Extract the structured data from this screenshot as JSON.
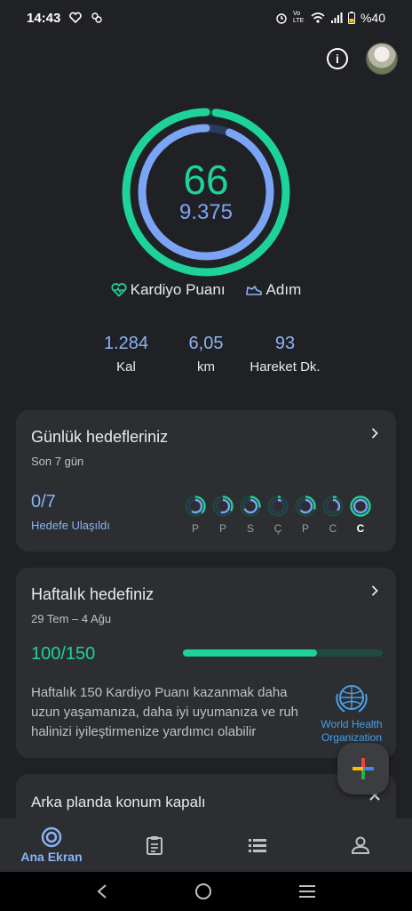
{
  "status_bar": {
    "time": "14:43",
    "battery": "%40",
    "signal_labels": "Vo LTE"
  },
  "ring": {
    "cardio_points": "66",
    "steps": "9.375",
    "cardio_progress": 0.98,
    "steps_progress": 0.94
  },
  "legend": {
    "cardio_label": "Kardiyo Puanı",
    "steps_label": "Adım"
  },
  "stats": [
    {
      "value": "1.284",
      "label": "Kal"
    },
    {
      "value": "6,05",
      "label": "km"
    },
    {
      "value": "93",
      "label": "Hareket Dk."
    }
  ],
  "daily_card": {
    "title": "Günlük hedefleriniz",
    "subtitle": "Son 7 gün",
    "count": "0/7",
    "count_label": "Hedefe Ulaşıldı",
    "days": [
      "P",
      "P",
      "S",
      "Ç",
      "P",
      "C",
      "C"
    ]
  },
  "weekly_card": {
    "title": "Haftalık hedefiniz",
    "date_range": "29 Tem – 4 Ağu",
    "count": "100/150",
    "progress": 0.67,
    "description": "Haftalık 150 Kardiyo Puanı kazanmak daha uzun yaşamanıza, daha iyi uyumanıza ve ruh halinizi iyileştirmenize yardımcı olabilir",
    "who_label_1": "World Health",
    "who_label_2": "Organization"
  },
  "background_card": {
    "title": "Arka planda konum kapalı"
  },
  "bottom_nav": {
    "home_label": "Ana Ekran"
  },
  "colors": {
    "accent_green": "#1ed39a",
    "accent_blue": "#8ab4f8",
    "background": "#202124",
    "card": "#2d2e31"
  }
}
